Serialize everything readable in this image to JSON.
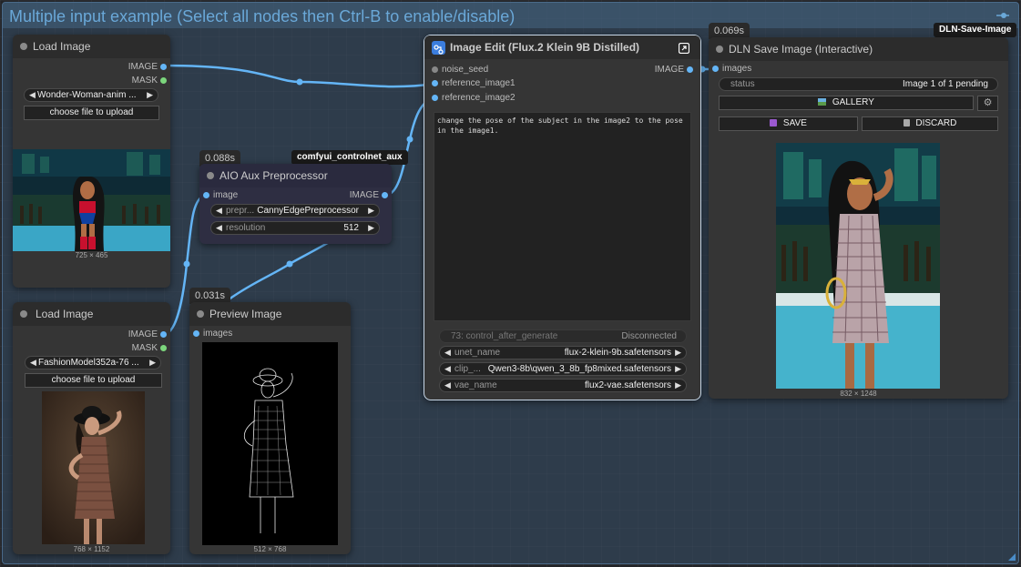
{
  "group": {
    "title": "Multiple input example  (Select all nodes then Ctrl-B to enable/disable)"
  },
  "load_image_1": {
    "title": "Load Image",
    "output_image": "IMAGE",
    "output_mask": "MASK",
    "file_value": "Wonder-Woman-anim ...",
    "upload_label": "choose file to upload",
    "caption": "725 × 465"
  },
  "load_image_2": {
    "title": "Load Image",
    "output_image": "IMAGE",
    "output_mask": "MASK",
    "file_value": "FashionModel352a-76 ...",
    "upload_label": "choose file to upload",
    "caption": "768 × 1152"
  },
  "aio_aux": {
    "timing": "0.088s",
    "badge": "comfyui_controlnet_aux",
    "title": "AIO Aux Preprocessor",
    "input_image": "image",
    "output_image": "IMAGE",
    "preprocessor_label": "prepr...",
    "preprocessor_value": "CannyEdgePreprocessor",
    "resolution_label": "resolution",
    "resolution_value": "512"
  },
  "preview_image": {
    "timing": "0.031s",
    "title": "Preview Image",
    "input_images": "images",
    "caption": "512 × 768"
  },
  "image_edit": {
    "title": "Image Edit (Flux.2 Klein 9B Distilled)",
    "input_noise": "noise_seed",
    "input_ref1": "reference_image1",
    "input_ref2": "reference_image2",
    "output_image": "IMAGE",
    "prompt": "change the pose of the subject in the image2 to the pose in the image1.",
    "control_after_label": "73: control_after_generate",
    "control_after_value": "Disconnected",
    "unet_label": "unet_name",
    "unet_value": "flux-2-klein-9b.safetensors",
    "clip_label": "clip_...",
    "clip_value": "Qwen3-8b\\qwen_3_8b_fp8mixed.safetensors",
    "vae_label": "vae_name",
    "vae_value": "flux2-vae.safetensors"
  },
  "dln_save": {
    "timing": "0.069s",
    "badge": "DLN-Save-Image",
    "title": "DLN Save Image (Interactive)",
    "input_images": "images",
    "status_label": "status",
    "status_value": "Image 1 of 1 pending",
    "gallery_label": "GALLERY",
    "save_label": "SAVE",
    "discard_label": "DISCARD",
    "caption": "832 × 1248"
  },
  "colors": {
    "wire": "#64b5f6",
    "group_title": "#6aa8d8",
    "selected_border": "#c8d8e8"
  }
}
